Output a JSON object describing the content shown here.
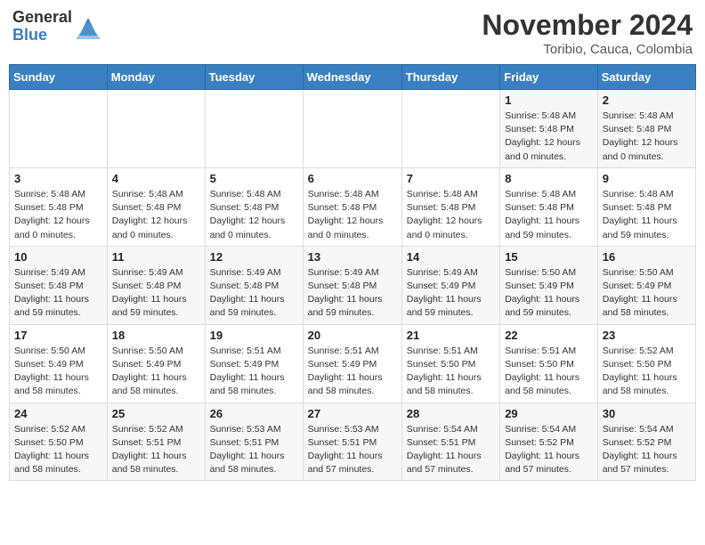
{
  "header": {
    "logo_general": "General",
    "logo_blue": "Blue",
    "month_year": "November 2024",
    "location": "Toribio, Cauca, Colombia"
  },
  "calendar": {
    "days_of_week": [
      "Sunday",
      "Monday",
      "Tuesday",
      "Wednesday",
      "Thursday",
      "Friday",
      "Saturday"
    ],
    "weeks": [
      [
        {
          "day": "",
          "info": ""
        },
        {
          "day": "",
          "info": ""
        },
        {
          "day": "",
          "info": ""
        },
        {
          "day": "",
          "info": ""
        },
        {
          "day": "",
          "info": ""
        },
        {
          "day": "1",
          "info": "Sunrise: 5:48 AM\nSunset: 5:48 PM\nDaylight: 12 hours\nand 0 minutes."
        },
        {
          "day": "2",
          "info": "Sunrise: 5:48 AM\nSunset: 5:48 PM\nDaylight: 12 hours\nand 0 minutes."
        }
      ],
      [
        {
          "day": "3",
          "info": "Sunrise: 5:48 AM\nSunset: 5:48 PM\nDaylight: 12 hours\nand 0 minutes."
        },
        {
          "day": "4",
          "info": "Sunrise: 5:48 AM\nSunset: 5:48 PM\nDaylight: 12 hours\nand 0 minutes."
        },
        {
          "day": "5",
          "info": "Sunrise: 5:48 AM\nSunset: 5:48 PM\nDaylight: 12 hours\nand 0 minutes."
        },
        {
          "day": "6",
          "info": "Sunrise: 5:48 AM\nSunset: 5:48 PM\nDaylight: 12 hours\nand 0 minutes."
        },
        {
          "day": "7",
          "info": "Sunrise: 5:48 AM\nSunset: 5:48 PM\nDaylight: 12 hours\nand 0 minutes."
        },
        {
          "day": "8",
          "info": "Sunrise: 5:48 AM\nSunset: 5:48 PM\nDaylight: 11 hours\nand 59 minutes."
        },
        {
          "day": "9",
          "info": "Sunrise: 5:48 AM\nSunset: 5:48 PM\nDaylight: 11 hours\nand 59 minutes."
        }
      ],
      [
        {
          "day": "10",
          "info": "Sunrise: 5:49 AM\nSunset: 5:48 PM\nDaylight: 11 hours\nand 59 minutes."
        },
        {
          "day": "11",
          "info": "Sunrise: 5:49 AM\nSunset: 5:48 PM\nDaylight: 11 hours\nand 59 minutes."
        },
        {
          "day": "12",
          "info": "Sunrise: 5:49 AM\nSunset: 5:48 PM\nDaylight: 11 hours\nand 59 minutes."
        },
        {
          "day": "13",
          "info": "Sunrise: 5:49 AM\nSunset: 5:48 PM\nDaylight: 11 hours\nand 59 minutes."
        },
        {
          "day": "14",
          "info": "Sunrise: 5:49 AM\nSunset: 5:49 PM\nDaylight: 11 hours\nand 59 minutes."
        },
        {
          "day": "15",
          "info": "Sunrise: 5:50 AM\nSunset: 5:49 PM\nDaylight: 11 hours\nand 59 minutes."
        },
        {
          "day": "16",
          "info": "Sunrise: 5:50 AM\nSunset: 5:49 PM\nDaylight: 11 hours\nand 58 minutes."
        }
      ],
      [
        {
          "day": "17",
          "info": "Sunrise: 5:50 AM\nSunset: 5:49 PM\nDaylight: 11 hours\nand 58 minutes."
        },
        {
          "day": "18",
          "info": "Sunrise: 5:50 AM\nSunset: 5:49 PM\nDaylight: 11 hours\nand 58 minutes."
        },
        {
          "day": "19",
          "info": "Sunrise: 5:51 AM\nSunset: 5:49 PM\nDaylight: 11 hours\nand 58 minutes."
        },
        {
          "day": "20",
          "info": "Sunrise: 5:51 AM\nSunset: 5:49 PM\nDaylight: 11 hours\nand 58 minutes."
        },
        {
          "day": "21",
          "info": "Sunrise: 5:51 AM\nSunset: 5:50 PM\nDaylight: 11 hours\nand 58 minutes."
        },
        {
          "day": "22",
          "info": "Sunrise: 5:51 AM\nSunset: 5:50 PM\nDaylight: 11 hours\nand 58 minutes."
        },
        {
          "day": "23",
          "info": "Sunrise: 5:52 AM\nSunset: 5:50 PM\nDaylight: 11 hours\nand 58 minutes."
        }
      ],
      [
        {
          "day": "24",
          "info": "Sunrise: 5:52 AM\nSunset: 5:50 PM\nDaylight: 11 hours\nand 58 minutes."
        },
        {
          "day": "25",
          "info": "Sunrise: 5:52 AM\nSunset: 5:51 PM\nDaylight: 11 hours\nand 58 minutes."
        },
        {
          "day": "26",
          "info": "Sunrise: 5:53 AM\nSunset: 5:51 PM\nDaylight: 11 hours\nand 58 minutes."
        },
        {
          "day": "27",
          "info": "Sunrise: 5:53 AM\nSunset: 5:51 PM\nDaylight: 11 hours\nand 57 minutes."
        },
        {
          "day": "28",
          "info": "Sunrise: 5:54 AM\nSunset: 5:51 PM\nDaylight: 11 hours\nand 57 minutes."
        },
        {
          "day": "29",
          "info": "Sunrise: 5:54 AM\nSunset: 5:52 PM\nDaylight: 11 hours\nand 57 minutes."
        },
        {
          "day": "30",
          "info": "Sunrise: 5:54 AM\nSunset: 5:52 PM\nDaylight: 11 hours\nand 57 minutes."
        }
      ]
    ]
  }
}
